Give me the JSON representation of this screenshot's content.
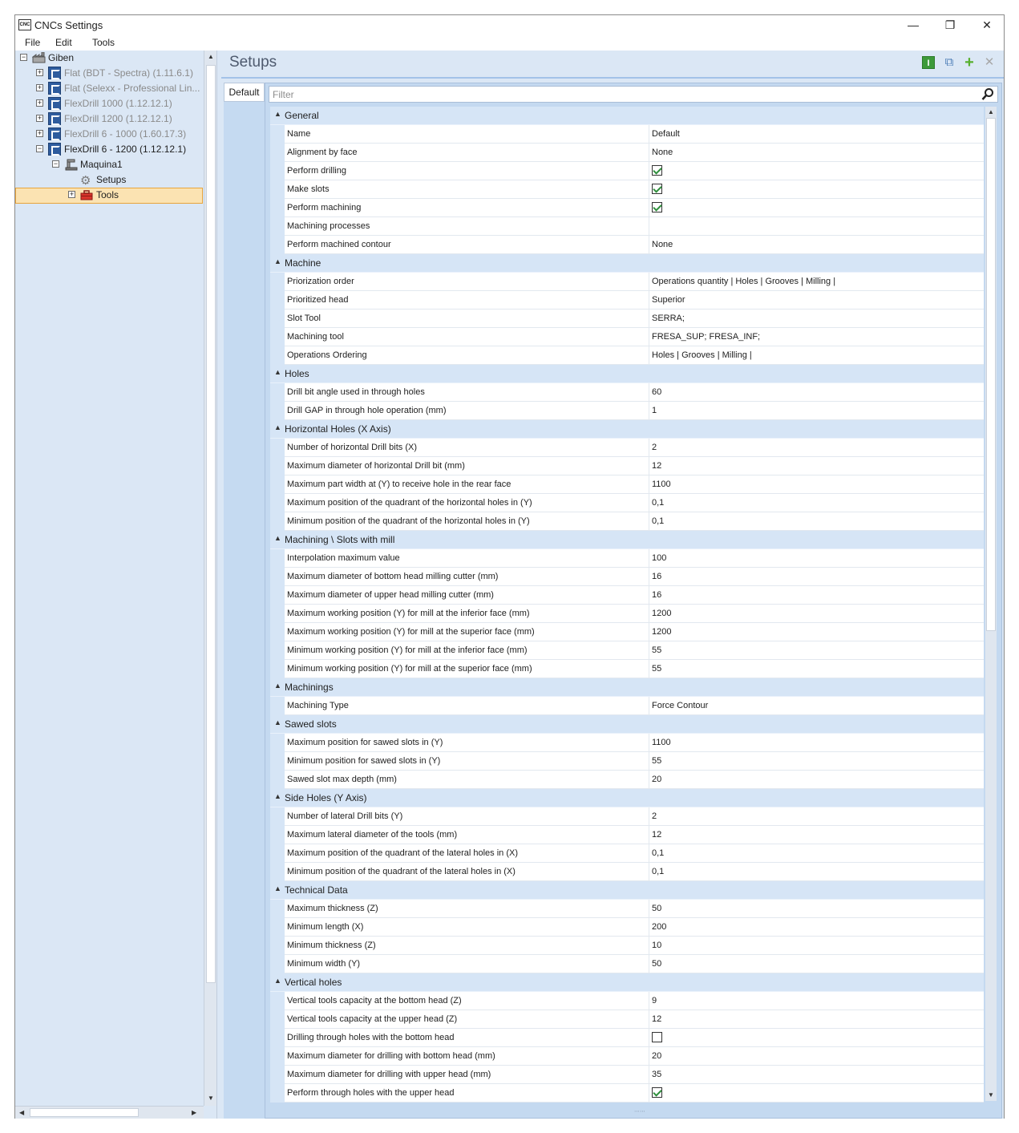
{
  "window": {
    "title": "CNCs Settings",
    "icon_text": "CNC",
    "controls": {
      "minimize": "—",
      "restore": "❐",
      "close": "✕"
    }
  },
  "menu": [
    "File",
    "Edit",
    "Tools"
  ],
  "tree": {
    "root": "Giben",
    "machines": [
      {
        "label": "Flat (BDT - Spectra) (1.11.6.1)",
        "enabled": false
      },
      {
        "label": "Flat (Selexx - Professional Lin...",
        "enabled": false
      },
      {
        "label": "FlexDrill 1000 (1.12.12.1)",
        "enabled": false
      },
      {
        "label": "FlexDrill 1200 (1.12.12.1)",
        "enabled": false
      },
      {
        "label": "FlexDrill 6 - 1000 (1.60.17.3)",
        "enabled": false
      },
      {
        "label": "FlexDrill 6 - 1200 (1.12.12.1)",
        "enabled": true
      }
    ],
    "sub": {
      "machine": "Maquina1",
      "setups": "Setups",
      "tools": "Tools"
    }
  },
  "main": {
    "title": "Setups",
    "tab": "Default",
    "filter_placeholder": "Filter",
    "icons": [
      "info-icon",
      "copy-icon",
      "add-icon",
      "delete-icon"
    ]
  },
  "colors": {
    "accent": "#a3c2e8",
    "selection": "#fbe3b2",
    "check": "#2f8f3c"
  },
  "categories": [
    {
      "name": "General",
      "rows": [
        {
          "name": "Name",
          "value": "Default"
        },
        {
          "name": "Alignment by face",
          "value": "None"
        },
        {
          "name": "Perform drilling",
          "check": true
        },
        {
          "name": "Make slots",
          "check": true
        },
        {
          "name": "Perform machining",
          "check": true
        },
        {
          "name": "Machining processes",
          "value": ""
        },
        {
          "name": "Perform machined contour",
          "value": "None"
        }
      ]
    },
    {
      "name": "Machine",
      "rows": [
        {
          "name": "Priorization order",
          "value": "Operations quantity | Holes | Grooves | Milling |"
        },
        {
          "name": "Prioritized head",
          "value": "Superior"
        },
        {
          "name": "Slot Tool",
          "value": "SERRA;"
        },
        {
          "name": "Machining tool",
          "value": "FRESA_SUP; FRESA_INF;"
        },
        {
          "name": "Operations Ordering",
          "value": "Holes | Grooves | Milling |"
        }
      ]
    },
    {
      "name": "Holes",
      "rows": [
        {
          "name": "Drill bit angle used in through holes",
          "value": "60"
        },
        {
          "name": "Drill GAP in through hole operation (mm)",
          "value": "1"
        }
      ]
    },
    {
      "name": "Horizontal Holes (X Axis)",
      "rows": [
        {
          "name": "Number of horizontal Drill bits (X)",
          "value": "2"
        },
        {
          "name": "Maximum diameter of horizontal Drill bit (mm)",
          "value": "12"
        },
        {
          "name": "Maximum part width at (Y) to receive hole in the rear face",
          "value": "1100"
        },
        {
          "name": "Maximum position of the quadrant of the horizontal holes in (Y)",
          "value": "0,1"
        },
        {
          "name": "Minimum position of the quadrant of the horizontal holes in (Y)",
          "value": "0,1"
        }
      ]
    },
    {
      "name": "Machining \\ Slots with mill",
      "rows": [
        {
          "name": "Interpolation maximum value",
          "value": "100"
        },
        {
          "name": "Maximum diameter of bottom head milling cutter (mm)",
          "value": "16"
        },
        {
          "name": "Maximum diameter of upper head milling cutter (mm)",
          "value": "16"
        },
        {
          "name": "Maximum working position (Y) for mill at the inferior face (mm)",
          "value": "1200"
        },
        {
          "name": "Maximum working position (Y) for mill at the superior face (mm)",
          "value": "1200"
        },
        {
          "name": "Minimum working position (Y) for mill at the inferior face (mm)",
          "value": "55"
        },
        {
          "name": "Minimum working position (Y) for mill at the superior face (mm)",
          "value": "55"
        }
      ]
    },
    {
      "name": "Machinings",
      "rows": [
        {
          "name": "Machining Type",
          "value": "Force Contour"
        }
      ]
    },
    {
      "name": "Sawed slots",
      "rows": [
        {
          "name": "Maximum position for sawed slots in (Y)",
          "value": "1100"
        },
        {
          "name": "Minimum position for sawed slots in (Y)",
          "value": "55"
        },
        {
          "name": "Sawed slot max depth (mm)",
          "value": "20"
        }
      ]
    },
    {
      "name": "Side Holes (Y Axis)",
      "rows": [
        {
          "name": "Number of lateral Drill bits (Y)",
          "value": "2"
        },
        {
          "name": "Maximum lateral diameter of the tools (mm)",
          "value": "12"
        },
        {
          "name": "Maximum position of the quadrant of the lateral holes in (X)",
          "value": "0,1"
        },
        {
          "name": "Minimum position of the quadrant of the lateral holes in (X)",
          "value": "0,1"
        }
      ]
    },
    {
      "name": "Technical Data",
      "rows": [
        {
          "name": "Maximum thickness (Z)",
          "value": "50"
        },
        {
          "name": "Minimum length (X)",
          "value": "200"
        },
        {
          "name": "Minimum thickness (Z)",
          "value": "10"
        },
        {
          "name": "Minimum width (Y)",
          "value": "50"
        }
      ]
    },
    {
      "name": "Vertical holes",
      "rows": [
        {
          "name": "Vertical tools capacity at the bottom head (Z)",
          "value": "9"
        },
        {
          "name": "Vertical tools capacity at the upper head (Z)",
          "value": "12"
        },
        {
          "name": "Drilling through holes with the bottom head",
          "check": false
        },
        {
          "name": "Maximum diameter for drilling with bottom head (mm)",
          "value": "20"
        },
        {
          "name": "Maximum diameter for drilling with upper head (mm)",
          "value": "35"
        },
        {
          "name": "Perform through holes with the upper head",
          "check": true
        }
      ]
    }
  ]
}
